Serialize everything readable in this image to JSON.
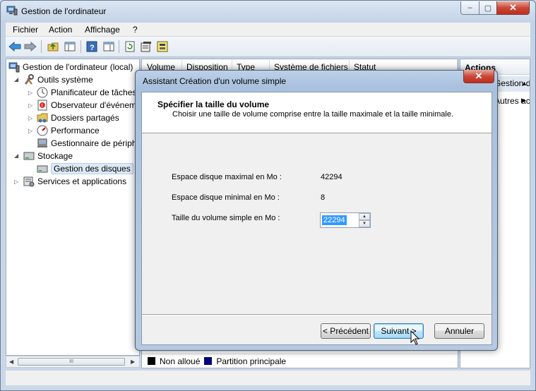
{
  "window": {
    "title": "Gestion de l'ordinateur",
    "minimize": "–",
    "maximize": "▢",
    "close": "✕"
  },
  "menu": [
    "Fichier",
    "Action",
    "Affichage",
    "?"
  ],
  "tree": {
    "root": "Gestion de l'ordinateur (local)",
    "items": [
      {
        "label": "Outils système"
      },
      {
        "label": "Planificateur de tâches"
      },
      {
        "label": "Observateur d'événements"
      },
      {
        "label": "Dossiers partagés"
      },
      {
        "label": "Performance"
      },
      {
        "label": "Gestionnaire de périphériques"
      },
      {
        "label": "Stockage"
      },
      {
        "label": "Gestion des disques"
      },
      {
        "label": "Services et applications"
      }
    ]
  },
  "hscroll_thumb": "III",
  "columns": [
    "Volume",
    "Disposition",
    "Type",
    "Système de fichiers",
    "Statut"
  ],
  "legend": [
    {
      "label": "Non alloué",
      "color": "#000000"
    },
    {
      "label": "Partition principale",
      "color": "#00007b"
    }
  ],
  "actions": {
    "header": "Actions",
    "item1": "Gestion de...",
    "item2": "Autres actions"
  },
  "dialog": {
    "title": "Assistant Création d'un volume simple",
    "close": "✕",
    "heading": "Spécifier la taille du volume",
    "subheading": "Choisir une taille de volume comprise entre la taille maximale et la taille minimale.",
    "max_label": "Espace disque maximal en Mo :",
    "max_value": "42294",
    "min_label": "Espace disque minimal en Mo :",
    "min_value": "8",
    "size_label": "Taille du volume simple en Mo :",
    "size_value": "22294",
    "buttons": {
      "back": "< Précédent",
      "next": "Suivant >",
      "cancel": "Annuler"
    }
  }
}
